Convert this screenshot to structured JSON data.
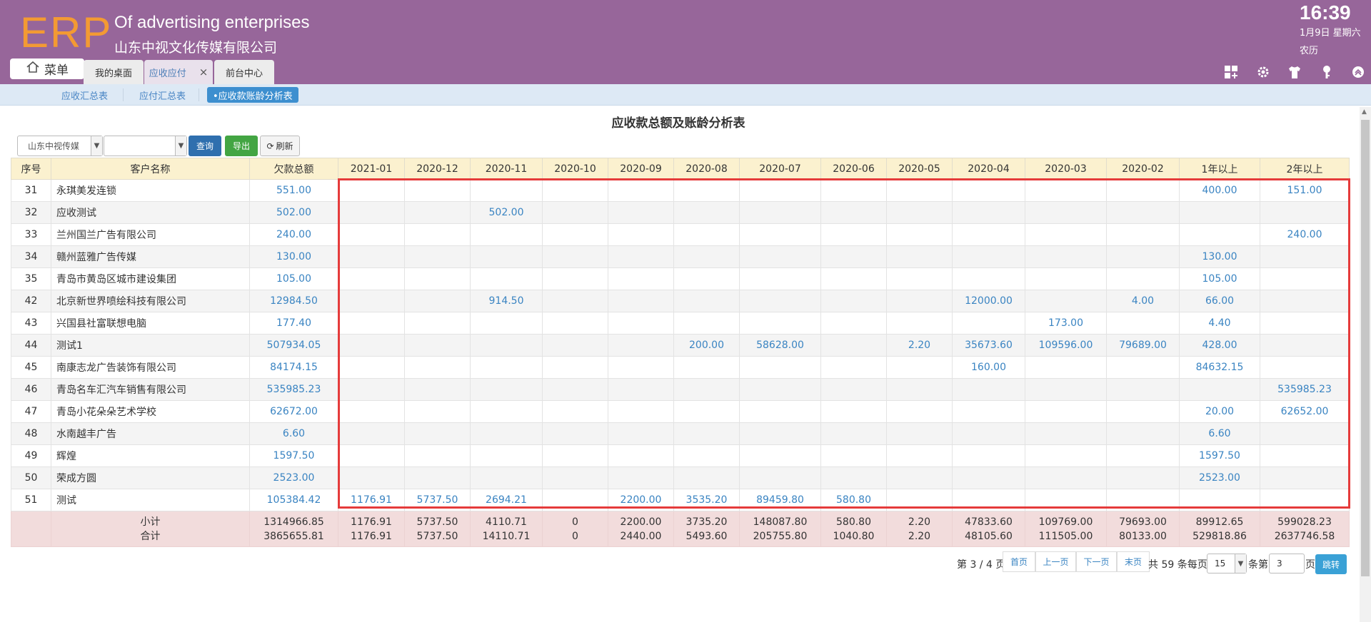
{
  "header": {
    "logo": "ERP",
    "company_en": "Of advertising enterprises",
    "company_cn": "山东中视文化传媒有限公司",
    "time": "16:39",
    "date": "1月9日 星期六",
    "lunar": "农历",
    "menu_label": "菜单",
    "tabs": [
      {
        "label": "我的桌面"
      },
      {
        "label": "应收应付",
        "close": "×"
      },
      {
        "label": "前台中心"
      }
    ],
    "icons": [
      "grid-add-icon",
      "gear-icon",
      "shirt-icon",
      "key-icon",
      "chevron-up-circle-icon"
    ]
  },
  "subnav": {
    "items": [
      {
        "label": "应收汇总表"
      },
      {
        "label": "应付汇总表"
      },
      {
        "label": "•应收款账龄分析表"
      }
    ]
  },
  "page": {
    "title": "应收款总额及账龄分析表",
    "company_select": "山东中视传媒",
    "second_select": "",
    "query_label": "查询",
    "export_label": "导出",
    "refresh_label": "刷新"
  },
  "table": {
    "headers": [
      "序号",
      "客户名称",
      "欠款总额",
      "2021-01",
      "2020-12",
      "2020-11",
      "2020-10",
      "2020-09",
      "2020-08",
      "2020-07",
      "2020-06",
      "2020-05",
      "2020-04",
      "2020-03",
      "2020-02",
      "1年以上",
      "2年以上"
    ],
    "rows": [
      [
        "31",
        "永琪美发连锁",
        "551.00",
        "",
        "",
        "",
        "",
        "",
        "",
        "",
        "",
        "",
        "",
        "",
        "",
        "400.00",
        "151.00"
      ],
      [
        "32",
        "应收测试",
        "502.00",
        "",
        "",
        "502.00",
        "",
        "",
        "",
        "",
        "",
        "",
        "",
        "",
        "",
        "",
        ""
      ],
      [
        "33",
        "兰州国兰广告有限公司",
        "240.00",
        "",
        "",
        "",
        "",
        "",
        "",
        "",
        "",
        "",
        "",
        "",
        "",
        "",
        "240.00"
      ],
      [
        "34",
        "赣州蓝雅广告传媒",
        "130.00",
        "",
        "",
        "",
        "",
        "",
        "",
        "",
        "",
        "",
        "",
        "",
        "",
        "130.00",
        ""
      ],
      [
        "35",
        "青岛市黄岛区城市建设集团",
        "105.00",
        "",
        "",
        "",
        "",
        "",
        "",
        "",
        "",
        "",
        "",
        "",
        "",
        "105.00",
        ""
      ],
      [
        "42",
        "北京新世界喷绘科技有限公司",
        "12984.50",
        "",
        "",
        "914.50",
        "",
        "",
        "",
        "",
        "",
        "",
        "12000.00",
        "",
        "4.00",
        "66.00",
        ""
      ],
      [
        "43",
        "兴国县社富联想电脑",
        "177.40",
        "",
        "",
        "",
        "",
        "",
        "",
        "",
        "",
        "",
        "",
        "173.00",
        "",
        "4.40",
        ""
      ],
      [
        "44",
        "测试1",
        "507934.05",
        "",
        "",
        "",
        "",
        "",
        "200.00",
        "58628.00",
        "",
        "2.20",
        "35673.60",
        "109596.00",
        "79689.00",
        "428.00",
        ""
      ],
      [
        "45",
        "南康志龙广告装饰有限公司",
        "84174.15",
        "",
        "",
        "",
        "",
        "",
        "",
        "",
        "",
        "",
        "160.00",
        "",
        "",
        "84632.15",
        ""
      ],
      [
        "46",
        "青岛名车汇汽车销售有限公司",
        "535985.23",
        "",
        "",
        "",
        "",
        "",
        "",
        "",
        "",
        "",
        "",
        "",
        "",
        "",
        "535985.23"
      ],
      [
        "47",
        "青岛小花朵朵艺术学校",
        "62672.00",
        "",
        "",
        "",
        "",
        "",
        "",
        "",
        "",
        "",
        "",
        "",
        "",
        "20.00",
        "62652.00"
      ],
      [
        "48",
        "水南越丰广告",
        "6.60",
        "",
        "",
        "",
        "",
        "",
        "",
        "",
        "",
        "",
        "",
        "",
        "",
        "6.60",
        ""
      ],
      [
        "49",
        "辉煌",
        "1597.50",
        "",
        "",
        "",
        "",
        "",
        "",
        "",
        "",
        "",
        "",
        "",
        "",
        "1597.50",
        ""
      ],
      [
        "50",
        "荣成方圆",
        "2523.00",
        "",
        "",
        "",
        "",
        "",
        "",
        "",
        "",
        "",
        "",
        "",
        "",
        "2523.00",
        ""
      ],
      [
        "51",
        "测试",
        "105384.42",
        "1176.91",
        "5737.50",
        "2694.21",
        "",
        "2200.00",
        "3535.20",
        "89459.80",
        "580.80",
        "",
        "",
        "",
        "",
        "",
        ""
      ]
    ],
    "subtotal_label": "小计",
    "total_label": "合计",
    "subtotal": [
      "1314966.85",
      "1176.91",
      "5737.50",
      "4110.71",
      "0",
      "2200.00",
      "3735.20",
      "148087.80",
      "580.80",
      "2.20",
      "47833.60",
      "109769.00",
      "79693.00",
      "89912.65",
      "599028.23"
    ],
    "total": [
      "3865655.81",
      "1176.91",
      "5737.50",
      "14110.71",
      "0",
      "2440.00",
      "5493.60",
      "205755.80",
      "1040.80",
      "2.20",
      "48105.60",
      "111505.00",
      "80133.00",
      "529818.86",
      "2637746.58"
    ]
  },
  "pager": {
    "page_info": "第 3 / 4 页",
    "first": "首页",
    "prev": "上一页",
    "next": "下一页",
    "last": "末页",
    "total_text": "共 59 条每页",
    "page_size": "15",
    "per_label": "条第",
    "page_input": "3",
    "page_suffix": "页",
    "go_label": "跳转"
  },
  "colors": {
    "header_bg": "#97669a",
    "logo": "#f39a33",
    "link_blue": "#3a84c2",
    "highlight_red": "#e53b3b",
    "table_header_bg": "#fbf1cf",
    "summary_bg": "#f2dcdc"
  }
}
